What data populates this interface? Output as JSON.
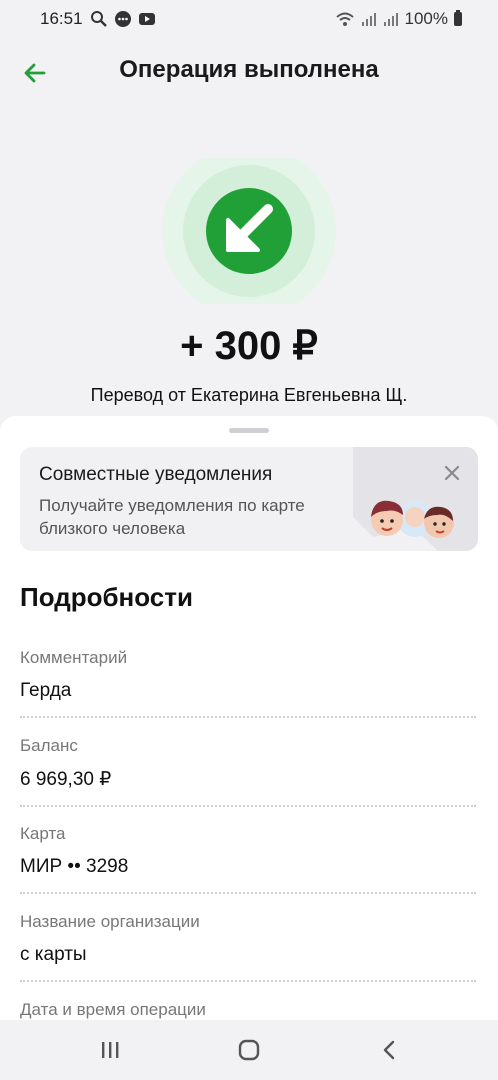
{
  "status_bar": {
    "time": "16:51",
    "battery": "100%"
  },
  "header": {
    "title": "Операция выполнена"
  },
  "operation": {
    "amount": "+ 300 ₽",
    "description": "Перевод от Екатерина Евгеньевна Щ."
  },
  "banner": {
    "title": "Совместные уведомления",
    "text": "Получайте уведомления по карте близкого человека"
  },
  "details": {
    "title": "Подробности",
    "rows": [
      {
        "label": "Комментарий",
        "value": "Герда"
      },
      {
        "label": "Баланс",
        "value": "6 969,30 ₽"
      },
      {
        "label": "Карта",
        "value": "МИР •• 3298"
      },
      {
        "label": "Название организации",
        "value": "с карты"
      },
      {
        "label": "Дата и время операции",
        "value": ""
      }
    ]
  },
  "colors": {
    "accent": "#21a038",
    "accent_light": "#d3efd9",
    "accent_lighter": "#e6f5e9"
  }
}
